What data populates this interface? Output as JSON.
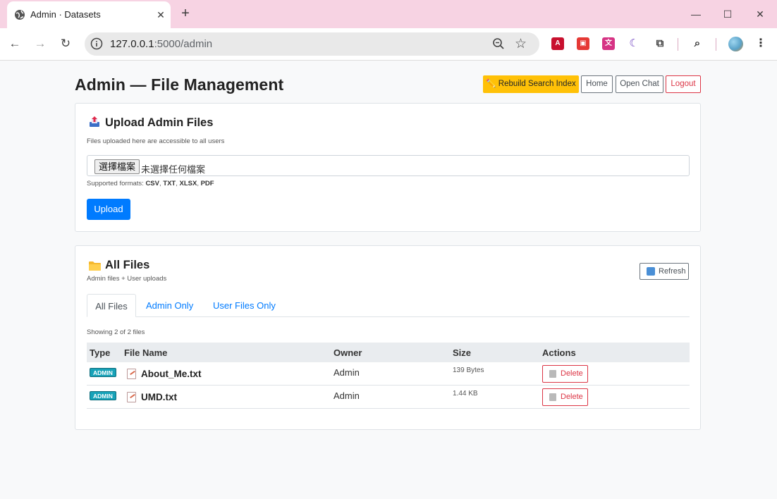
{
  "browser": {
    "tab_title": "Admin · Datasets",
    "tab_close": "✕",
    "new_tab": "+",
    "window_minimize": "—",
    "window_maximize": "☐",
    "window_close": "✕",
    "url_host": "127.0.0.1",
    "url_rest": ":5000/admin",
    "back": "←",
    "forward": "→",
    "reload": "↻",
    "star": "☆",
    "menu": "⋮",
    "extensions": [
      {
        "name": "pdf-extension-icon",
        "color": "#c8102e",
        "glyph": "A"
      },
      {
        "name": "save-extension-icon",
        "color": "#e53935",
        "glyph": "▣"
      },
      {
        "name": "translate-extension-icon",
        "color": "#d63384",
        "glyph": "文"
      },
      {
        "name": "moon-extension-icon",
        "color": "#6f42c1",
        "glyph": "☾"
      },
      {
        "name": "puzzle-extension-icon",
        "color": "#444444",
        "glyph": "⧉"
      },
      {
        "name": "tab-search-icon",
        "color": "#333333",
        "glyph": "⌕"
      }
    ]
  },
  "header": {
    "title": "Admin — File Management",
    "rebuild_label": "✏️ Rebuild Search Index",
    "home_label": "Home",
    "chat_label": "Open Chat",
    "logout_label": "Logout"
  },
  "upload": {
    "title": "Upload Admin Files",
    "subtitle": "Files uploaded here are accessible to all users",
    "choose_label": "選擇檔案",
    "no_file_text": "未選擇任何檔案",
    "formats_prefix": "Supported formats:",
    "formats": [
      "CSV",
      "TXT",
      "XLSX",
      "PDF"
    ],
    "upload_label": "Upload"
  },
  "files": {
    "title": "All Files",
    "subtitle": "Admin files + User uploads",
    "refresh_label": "Refresh",
    "tabs": [
      {
        "label": "All Files",
        "active": true
      },
      {
        "label": "Admin Only",
        "active": false
      },
      {
        "label": "User Files Only",
        "active": false
      }
    ],
    "showing_text": "Showing 2 of 2 files",
    "columns": {
      "type": "Type",
      "name": "File Name",
      "owner": "Owner",
      "size": "Size",
      "actions": "Actions"
    },
    "rows": [
      {
        "badge": "ADMIN",
        "name": "About_Me.txt",
        "owner": "Admin",
        "size": "139 Bytes",
        "action": "Delete"
      },
      {
        "badge": "ADMIN",
        "name": "UMD.txt",
        "owner": "Admin",
        "size": "1.44 KB",
        "action": "Delete"
      }
    ]
  },
  "colors": {
    "primary": "#007bff",
    "warning": "#ffc107",
    "danger": "#dc3545",
    "info": "#17a2b8",
    "tab_strip": "#f7d3e3"
  }
}
